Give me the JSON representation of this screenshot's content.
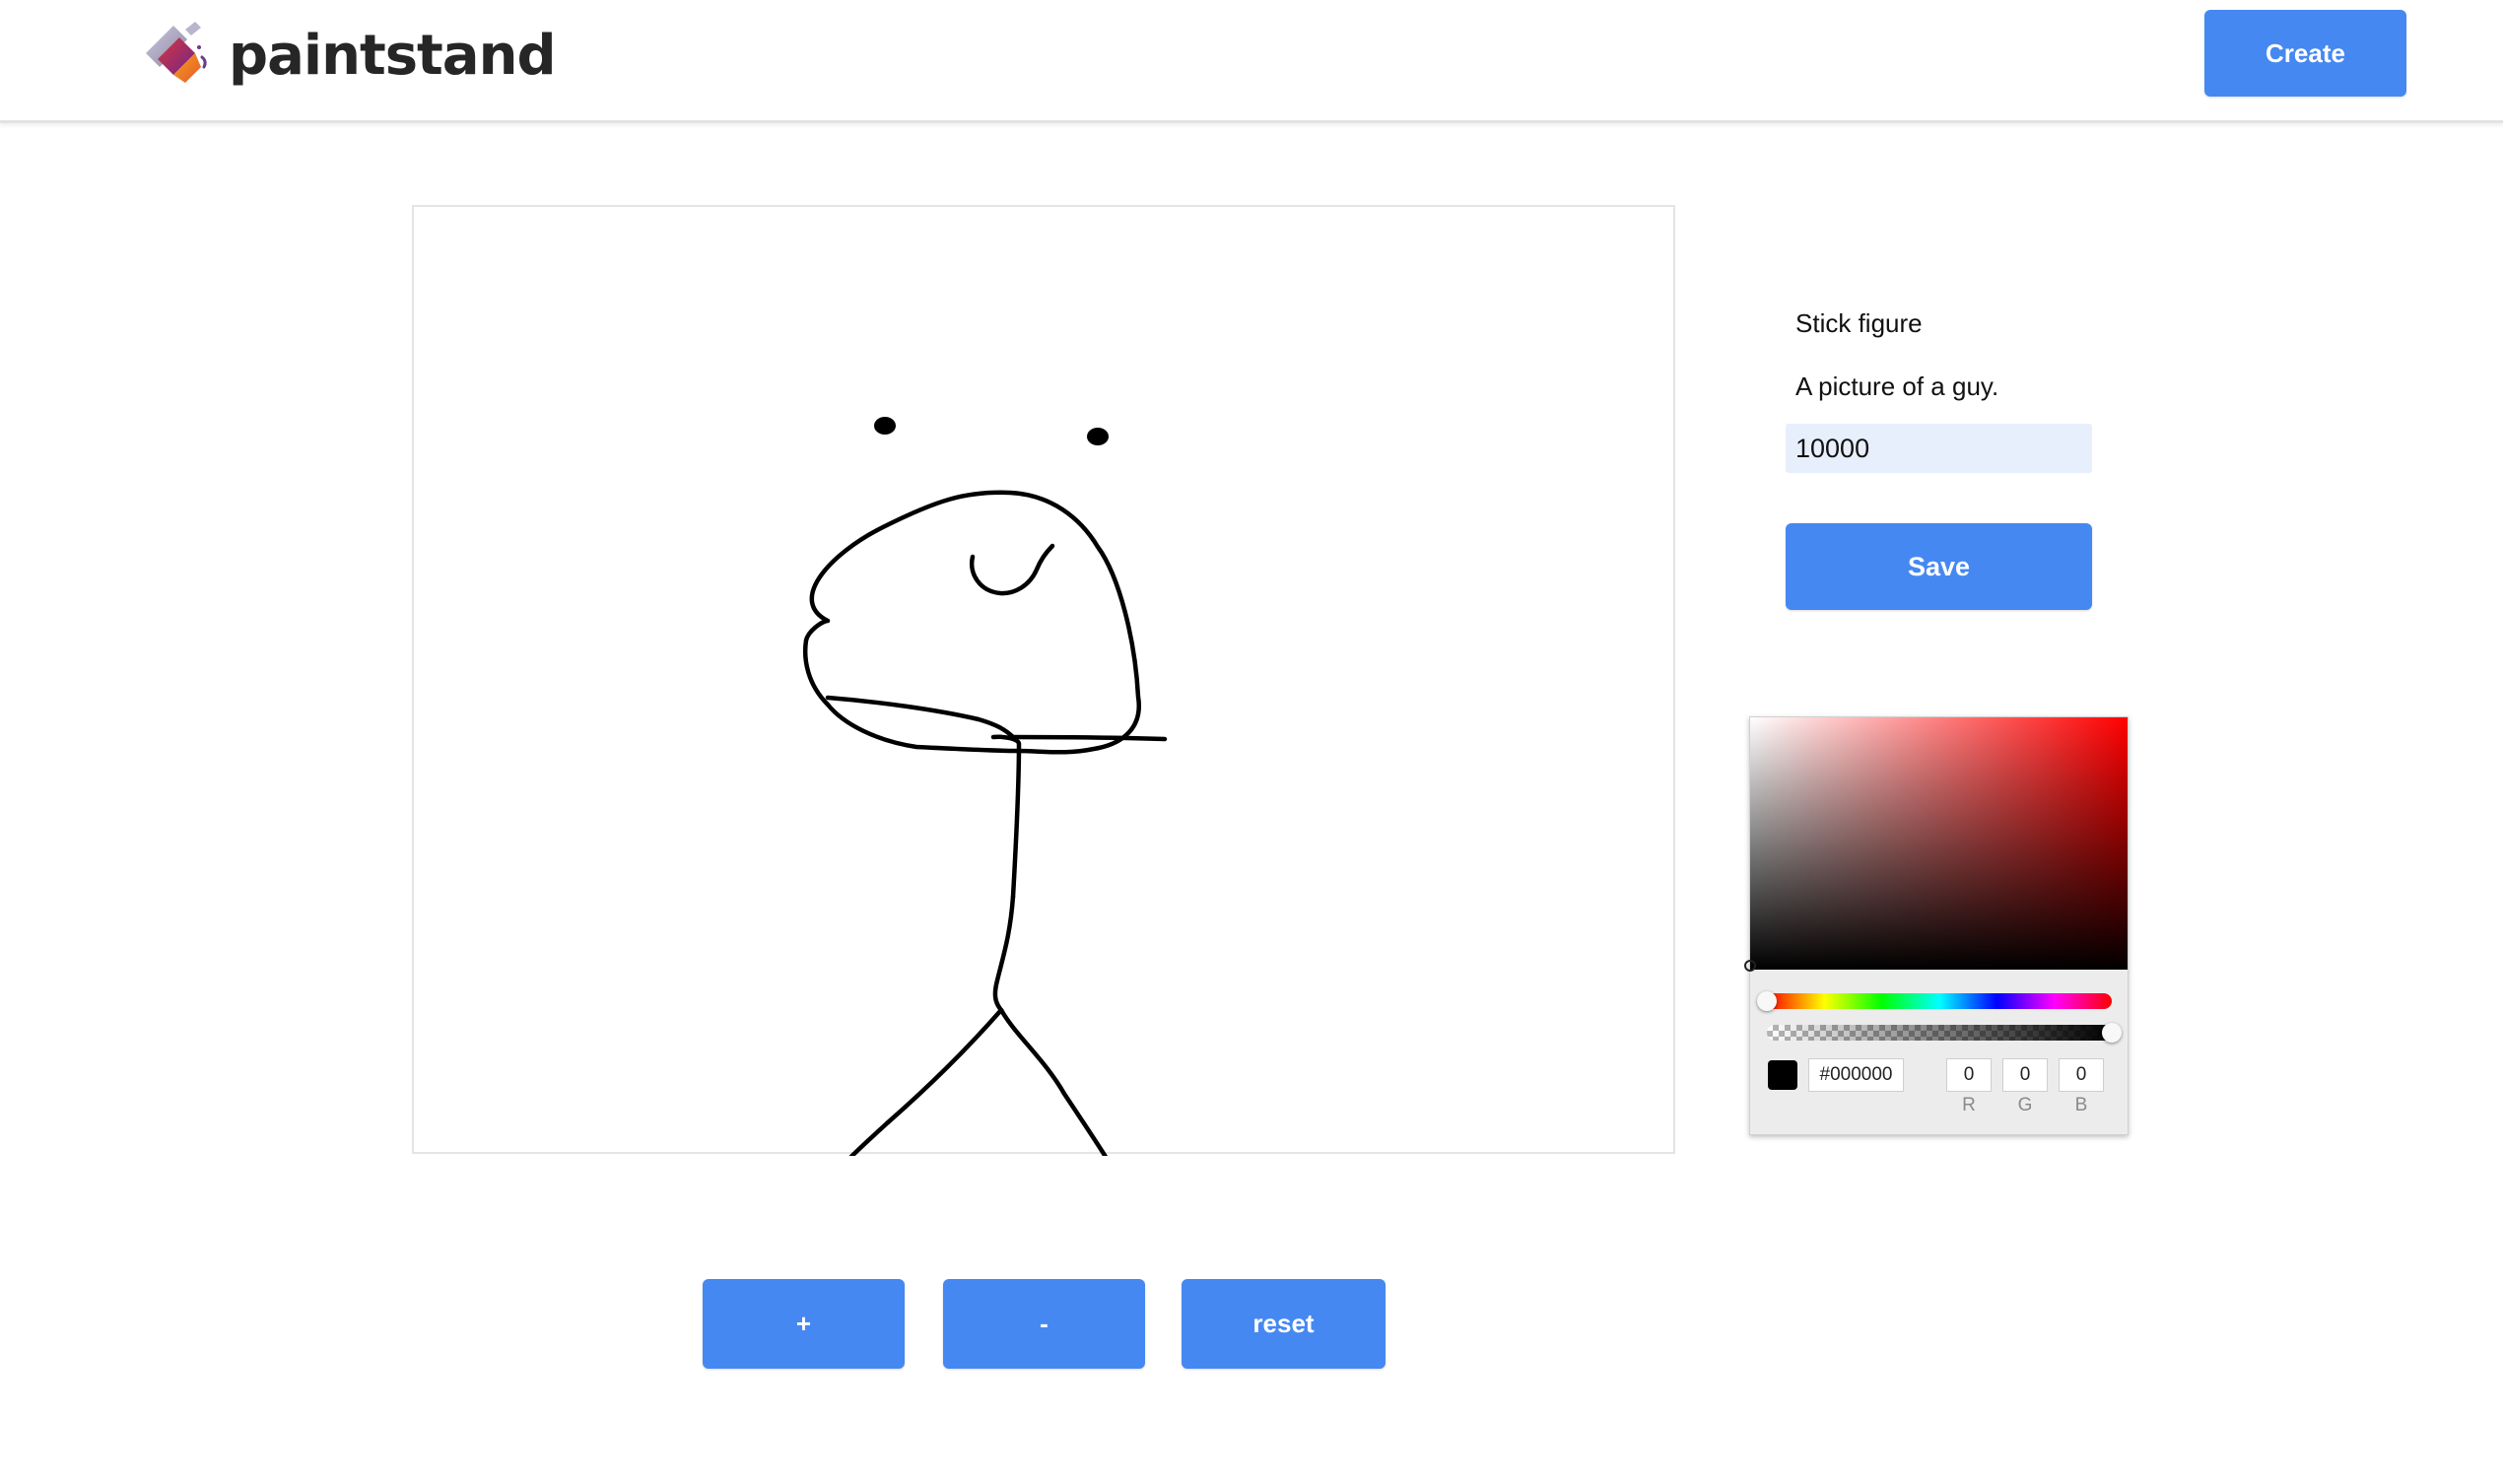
{
  "header": {
    "brand": "paintstand",
    "create_label": "Create"
  },
  "artwork": {
    "title": "Stick figure",
    "description": "A picture of a guy.",
    "price_value": "10000",
    "save_label": "Save"
  },
  "color_picker": {
    "hex": "#000000",
    "r": "0",
    "g": "0",
    "b": "0",
    "r_label": "R",
    "g_label": "G",
    "b_label": "B",
    "hue": 0,
    "alpha": 1,
    "selected_color": "#000000"
  },
  "controls": {
    "plus_label": "+",
    "minus_label": "-",
    "reset_label": "reset"
  },
  "theme": {
    "accent": "#4688f1",
    "input_bg": "#e8effc"
  }
}
